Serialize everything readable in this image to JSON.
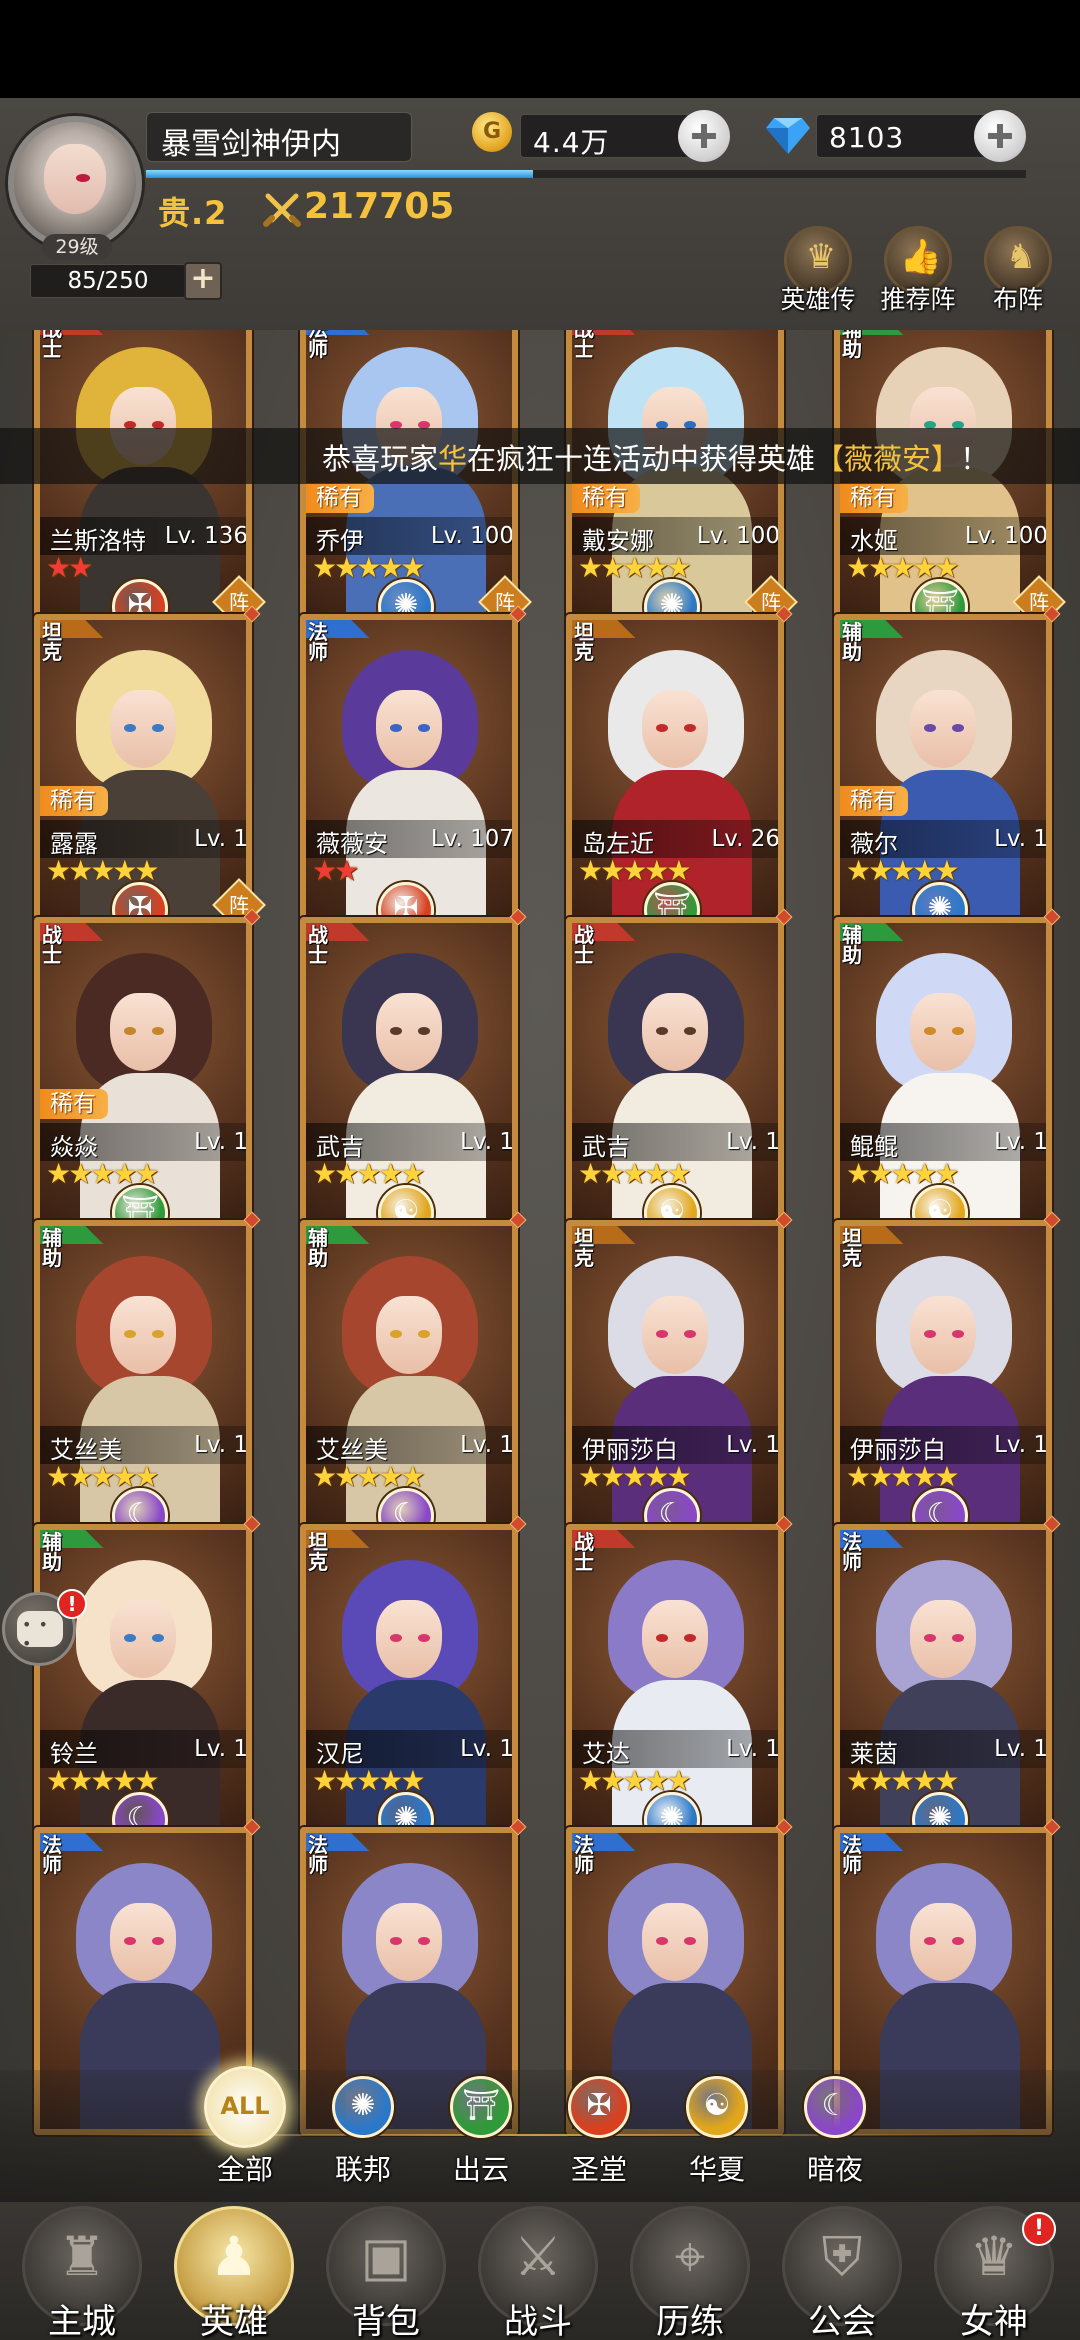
{
  "player": {
    "name": "暴雪剑神伊内",
    "level_badge": "29级",
    "vip": "贵.2",
    "power": "217705",
    "exp_fraction": 0.44
  },
  "currency": {
    "gold": "4.4万",
    "gems": "8103",
    "gold_icon": "G"
  },
  "roster": {
    "capacity": "85/250",
    "add_label": "+"
  },
  "top_actions": [
    {
      "label": "英雄传",
      "icon": "crown-icon",
      "glyph": "♛"
    },
    {
      "label": "推荐阵",
      "icon": "thumbs-up-icon",
      "glyph": "👍"
    },
    {
      "label": "布阵",
      "icon": "knight-icon",
      "glyph": "♞"
    }
  ],
  "marquee": {
    "prefix": "恭喜玩家",
    "player": "华",
    "middle": "在疯狂十连活动中获得英雄",
    "hero": "【薇薇安】",
    "suffix": "！"
  },
  "colors": {
    "class_warrior": "#c0392b",
    "class_mage": "#2f6fd0",
    "class_support": "#2e9a3e",
    "class_tank": "#b86b19",
    "faction_holy": "#d8401f",
    "faction_union": "#2c78c8",
    "faction_cloud": "#2f9a3a",
    "faction_huaxia": "#e2a61a",
    "faction_night": "#8a47c8"
  },
  "heroes": [
    {
      "class": "战士",
      "class_key": "warrior",
      "name": "兰斯洛特",
      "level": "Lv. 136",
      "rare": "",
      "stars": "★★",
      "star_color": "red",
      "faction": "holy",
      "faction_glyph": "✠",
      "lineup": "阵",
      "hair": "#e0b43a",
      "outfit": "#3a3530",
      "eye": "#c22a2a"
    },
    {
      "class": "法师",
      "class_key": "mage",
      "name": "乔伊",
      "level": "Lv. 100",
      "rare": "稀有",
      "stars": "★★★★★",
      "star_color": "gold",
      "faction": "union",
      "faction_glyph": "✺",
      "lineup": "阵",
      "hair": "#a8c6f0",
      "outfit": "#4a6fb6",
      "eye": "#d9376b"
    },
    {
      "class": "战士",
      "class_key": "warrior",
      "name": "戴安娜",
      "level": "Lv. 100",
      "rare": "稀有",
      "stars": "★★★★★",
      "star_color": "gold",
      "faction": "union",
      "faction_glyph": "✺",
      "lineup": "阵",
      "hair": "#bfe3f5",
      "outfit": "#d9c99a",
      "eye": "#2c6fc0"
    },
    {
      "class": "辅助",
      "class_key": "support",
      "name": "水姬",
      "level": "Lv. 100",
      "rare": "稀有",
      "stars": "★★★★★",
      "star_color": "gold",
      "faction": "cloud",
      "faction_glyph": "⛩",
      "lineup": "阵",
      "hair": "#e7d2b8",
      "outfit": "#e0c28a",
      "eye": "#27a38a"
    },
    {
      "class": "坦克",
      "class_key": "tank",
      "name": "露露",
      "level": "Lv. 1",
      "rare": "稀有",
      "stars": "★★★★★",
      "star_color": "gold",
      "faction": "holy",
      "faction_glyph": "✠",
      "lineup": "阵",
      "hair": "#f1dc9e",
      "outfit": "#4a4038",
      "eye": "#3b7ac4"
    },
    {
      "class": "法师",
      "class_key": "mage",
      "name": "薇薇安",
      "level": "Lv. 107",
      "rare": "",
      "stars": "★★",
      "star_color": "red",
      "faction": "holy",
      "faction_glyph": "✠",
      "lineup": "",
      "hair": "#5a3a9a",
      "outfit": "#ece6e0",
      "eye": "#3b64c4"
    },
    {
      "class": "坦克",
      "class_key": "tank",
      "name": "岛左近",
      "level": "Lv. 26",
      "rare": "",
      "stars": "★★★★★",
      "star_color": "gold",
      "faction": "cloud",
      "faction_glyph": "⛩",
      "lineup": "",
      "hair": "#e9e9ea",
      "outfit": "#b0232a",
      "eye": "#c22a2a"
    },
    {
      "class": "辅助",
      "class_key": "support",
      "name": "薇尔",
      "level": "Lv. 1",
      "rare": "稀有",
      "stars": "★★★★★",
      "star_color": "gold",
      "faction": "union",
      "faction_glyph": "✺",
      "lineup": "",
      "hair": "#e8d6c2",
      "outfit": "#3a5bb0",
      "eye": "#6a4aa8"
    },
    {
      "class": "战士",
      "class_key": "warrior",
      "name": "焱焱",
      "level": "Lv. 1",
      "rare": "稀有",
      "stars": "★★★★★",
      "star_color": "gold",
      "faction": "cloud",
      "faction_glyph": "⛩",
      "lineup": "",
      "hair": "#4a2a22",
      "outfit": "#e9e1d8",
      "eye": "#c7852a"
    },
    {
      "class": "战士",
      "class_key": "warrior",
      "name": "武吉",
      "level": "Lv. 1",
      "rare": "",
      "stars": "★★★★★",
      "star_color": "gold",
      "faction": "huaxia",
      "faction_glyph": "☯",
      "lineup": "",
      "hair": "#3a3550",
      "outfit": "#f2ece0",
      "eye": "#5a3a2a"
    },
    {
      "class": "战士",
      "class_key": "warrior",
      "name": "武吉",
      "level": "Lv. 1",
      "rare": "",
      "stars": "★★★★★",
      "star_color": "gold",
      "faction": "huaxia",
      "faction_glyph": "☯",
      "lineup": "",
      "hair": "#3a3550",
      "outfit": "#f2ece0",
      "eye": "#5a3a2a"
    },
    {
      "class": "辅助",
      "class_key": "support",
      "name": "鲲鲲",
      "level": "Lv. 1",
      "rare": "",
      "stars": "★★★★★",
      "star_color": "gold",
      "faction": "huaxia",
      "faction_glyph": "☯",
      "lineup": "",
      "hair": "#cfd8f5",
      "outfit": "#f7f3ef",
      "eye": "#d08a2a"
    },
    {
      "class": "辅助",
      "class_key": "support",
      "name": "艾丝美",
      "level": "Lv. 1",
      "rare": "",
      "stars": "★★★★★",
      "star_color": "gold",
      "faction": "night",
      "faction_glyph": "☾",
      "lineup": "",
      "hair": "#a6462e",
      "outfit": "#d8c7a6",
      "eye": "#d9a22a"
    },
    {
      "class": "辅助",
      "class_key": "support",
      "name": "艾丝美",
      "level": "Lv. 1",
      "rare": "",
      "stars": "★★★★★",
      "star_color": "gold",
      "faction": "night",
      "faction_glyph": "☾",
      "lineup": "",
      "hair": "#a6462e",
      "outfit": "#d8c7a6",
      "eye": "#d9a22a"
    },
    {
      "class": "坦克",
      "class_key": "tank",
      "name": "伊丽莎白",
      "level": "Lv. 1",
      "rare": "",
      "stars": "★★★★★",
      "star_color": "gold",
      "faction": "night",
      "faction_glyph": "☾",
      "lineup": "",
      "hair": "#dcdce6",
      "outfit": "#5a2e7a",
      "eye": "#d9376b"
    },
    {
      "class": "坦克",
      "class_key": "tank",
      "name": "伊丽莎白",
      "level": "Lv. 1",
      "rare": "",
      "stars": "★★★★★",
      "star_color": "gold",
      "faction": "night",
      "faction_glyph": "☾",
      "lineup": "",
      "hair": "#dcdce6",
      "outfit": "#5a2e7a",
      "eye": "#d9376b"
    },
    {
      "class": "辅助",
      "class_key": "support",
      "name": "铃兰",
      "level": "Lv. 1",
      "rare": "",
      "stars": "★★★★★",
      "star_color": "gold",
      "faction": "night",
      "faction_glyph": "☾",
      "lineup": "",
      "hair": "#f5e2c8",
      "outfit": "#3a2a28",
      "eye": "#3b7ac4"
    },
    {
      "class": "坦克",
      "class_key": "tank",
      "name": "汉尼",
      "level": "Lv. 1",
      "rare": "",
      "stars": "★★★★★",
      "star_color": "gold",
      "faction": "union",
      "faction_glyph": "✺",
      "lineup": "",
      "hair": "#5a4ab8",
      "outfit": "#2a3a6a",
      "eye": "#d9376b"
    },
    {
      "class": "战士",
      "class_key": "warrior",
      "name": "艾达",
      "level": "Lv. 1",
      "rare": "",
      "stars": "★★★★★",
      "star_color": "gold",
      "faction": "union",
      "faction_glyph": "✺",
      "lineup": "",
      "hair": "#8a7ac8",
      "outfit": "#e8ecf2",
      "eye": "#c22a2a"
    },
    {
      "class": "法师",
      "class_key": "mage",
      "name": "莱茵",
      "level": "Lv. 1",
      "rare": "",
      "stars": "★★★★★",
      "star_color": "gold",
      "faction": "union",
      "faction_glyph": "✺",
      "lineup": "",
      "hair": "#a9a3d4",
      "outfit": "#40405a",
      "eye": "#d9376b"
    },
    {
      "class": "法师",
      "class_key": "mage",
      "name": "",
      "level": "",
      "rare": "",
      "stars": "",
      "star_color": "gold",
      "faction": "",
      "faction_glyph": "",
      "lineup": "",
      "hair": "#8a86c8",
      "outfit": "#3a3a5a",
      "eye": "#d9376b"
    },
    {
      "class": "法师",
      "class_key": "mage",
      "name": "",
      "level": "",
      "rare": "",
      "stars": "",
      "star_color": "gold",
      "faction": "",
      "faction_glyph": "",
      "lineup": "",
      "hair": "#8a86c8",
      "outfit": "#3a3a5a",
      "eye": "#d9376b"
    },
    {
      "class": "法师",
      "class_key": "mage",
      "name": "",
      "level": "",
      "rare": "",
      "stars": "",
      "star_color": "gold",
      "faction": "",
      "faction_glyph": "",
      "lineup": "",
      "hair": "#8a86c8",
      "outfit": "#3a3a5a",
      "eye": "#d9376b"
    },
    {
      "class": "法师",
      "class_key": "mage",
      "name": "",
      "level": "",
      "rare": "",
      "stars": "",
      "star_color": "gold",
      "faction": "",
      "faction_glyph": "",
      "lineup": "",
      "hair": "#8a86c8",
      "outfit": "#3a3a5a",
      "eye": "#d9376b"
    }
  ],
  "filters": [
    {
      "label": "全部",
      "key": "all",
      "glyph": "ALL",
      "active": true
    },
    {
      "label": "联邦",
      "key": "union",
      "glyph": "✺",
      "active": false
    },
    {
      "label": "出云",
      "key": "cloud",
      "glyph": "⛩",
      "active": false
    },
    {
      "label": "圣堂",
      "key": "holy",
      "glyph": "✠",
      "active": false
    },
    {
      "label": "华夏",
      "key": "huaxia",
      "glyph": "☯",
      "active": false
    },
    {
      "label": "暗夜",
      "key": "night",
      "glyph": "☾",
      "active": false
    }
  ],
  "nav": [
    {
      "label": "主城",
      "icon": "castle-icon",
      "glyph": "♜",
      "active": false,
      "alert": ""
    },
    {
      "label": "英雄",
      "icon": "hero-hood-icon",
      "glyph": "♟",
      "active": true,
      "alert": ""
    },
    {
      "label": "背包",
      "icon": "backpack-icon",
      "glyph": "▣",
      "active": false,
      "alert": ""
    },
    {
      "label": "战斗",
      "icon": "crossed-swords-icon",
      "glyph": "⚔",
      "active": false,
      "alert": ""
    },
    {
      "label": "历练",
      "icon": "map-pin-icon",
      "glyph": "⌖",
      "active": false,
      "alert": ""
    },
    {
      "label": "公会",
      "icon": "shield-cross-icon",
      "glyph": "⛨",
      "active": false,
      "alert": ""
    },
    {
      "label": "女神",
      "icon": "goddess-icon",
      "glyph": "♛",
      "active": false,
      "alert": "!"
    }
  ],
  "chat": {
    "alert": "!"
  }
}
